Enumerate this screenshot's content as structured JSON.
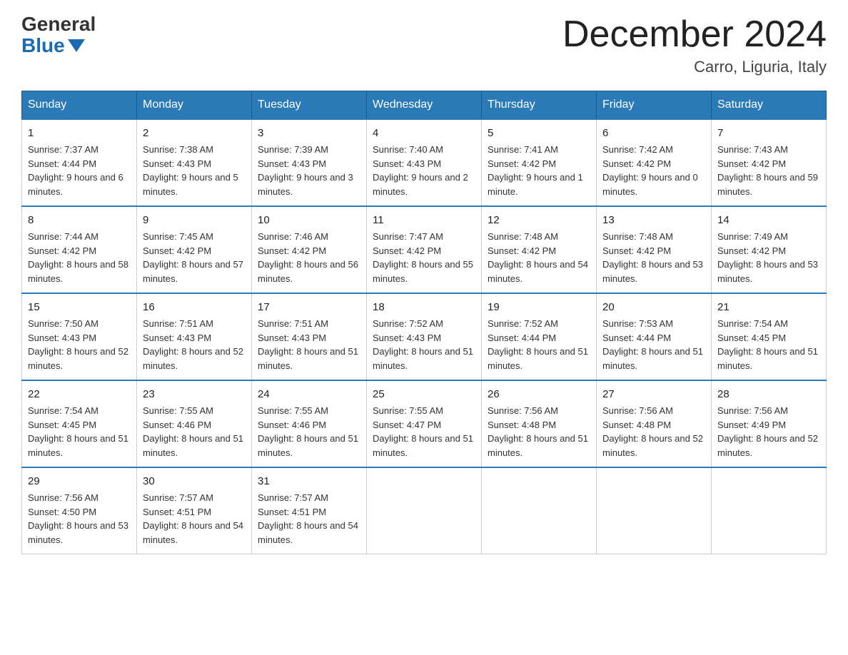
{
  "header": {
    "logo_general": "General",
    "logo_blue": "Blue",
    "month_title": "December 2024",
    "location": "Carro, Liguria, Italy"
  },
  "days_of_week": [
    "Sunday",
    "Monday",
    "Tuesday",
    "Wednesday",
    "Thursday",
    "Friday",
    "Saturday"
  ],
  "weeks": [
    [
      {
        "day": "1",
        "sunrise": "7:37 AM",
        "sunset": "4:44 PM",
        "daylight": "9 hours and 6 minutes."
      },
      {
        "day": "2",
        "sunrise": "7:38 AM",
        "sunset": "4:43 PM",
        "daylight": "9 hours and 5 minutes."
      },
      {
        "day": "3",
        "sunrise": "7:39 AM",
        "sunset": "4:43 PM",
        "daylight": "9 hours and 3 minutes."
      },
      {
        "day": "4",
        "sunrise": "7:40 AM",
        "sunset": "4:43 PM",
        "daylight": "9 hours and 2 minutes."
      },
      {
        "day": "5",
        "sunrise": "7:41 AM",
        "sunset": "4:42 PM",
        "daylight": "9 hours and 1 minute."
      },
      {
        "day": "6",
        "sunrise": "7:42 AM",
        "sunset": "4:42 PM",
        "daylight": "9 hours and 0 minutes."
      },
      {
        "day": "7",
        "sunrise": "7:43 AM",
        "sunset": "4:42 PM",
        "daylight": "8 hours and 59 minutes."
      }
    ],
    [
      {
        "day": "8",
        "sunrise": "7:44 AM",
        "sunset": "4:42 PM",
        "daylight": "8 hours and 58 minutes."
      },
      {
        "day": "9",
        "sunrise": "7:45 AM",
        "sunset": "4:42 PM",
        "daylight": "8 hours and 57 minutes."
      },
      {
        "day": "10",
        "sunrise": "7:46 AM",
        "sunset": "4:42 PM",
        "daylight": "8 hours and 56 minutes."
      },
      {
        "day": "11",
        "sunrise": "7:47 AM",
        "sunset": "4:42 PM",
        "daylight": "8 hours and 55 minutes."
      },
      {
        "day": "12",
        "sunrise": "7:48 AM",
        "sunset": "4:42 PM",
        "daylight": "8 hours and 54 minutes."
      },
      {
        "day": "13",
        "sunrise": "7:48 AM",
        "sunset": "4:42 PM",
        "daylight": "8 hours and 53 minutes."
      },
      {
        "day": "14",
        "sunrise": "7:49 AM",
        "sunset": "4:42 PM",
        "daylight": "8 hours and 53 minutes."
      }
    ],
    [
      {
        "day": "15",
        "sunrise": "7:50 AM",
        "sunset": "4:43 PM",
        "daylight": "8 hours and 52 minutes."
      },
      {
        "day": "16",
        "sunrise": "7:51 AM",
        "sunset": "4:43 PM",
        "daylight": "8 hours and 52 minutes."
      },
      {
        "day": "17",
        "sunrise": "7:51 AM",
        "sunset": "4:43 PM",
        "daylight": "8 hours and 51 minutes."
      },
      {
        "day": "18",
        "sunrise": "7:52 AM",
        "sunset": "4:43 PM",
        "daylight": "8 hours and 51 minutes."
      },
      {
        "day": "19",
        "sunrise": "7:52 AM",
        "sunset": "4:44 PM",
        "daylight": "8 hours and 51 minutes."
      },
      {
        "day": "20",
        "sunrise": "7:53 AM",
        "sunset": "4:44 PM",
        "daylight": "8 hours and 51 minutes."
      },
      {
        "day": "21",
        "sunrise": "7:54 AM",
        "sunset": "4:45 PM",
        "daylight": "8 hours and 51 minutes."
      }
    ],
    [
      {
        "day": "22",
        "sunrise": "7:54 AM",
        "sunset": "4:45 PM",
        "daylight": "8 hours and 51 minutes."
      },
      {
        "day": "23",
        "sunrise": "7:55 AM",
        "sunset": "4:46 PM",
        "daylight": "8 hours and 51 minutes."
      },
      {
        "day": "24",
        "sunrise": "7:55 AM",
        "sunset": "4:46 PM",
        "daylight": "8 hours and 51 minutes."
      },
      {
        "day": "25",
        "sunrise": "7:55 AM",
        "sunset": "4:47 PM",
        "daylight": "8 hours and 51 minutes."
      },
      {
        "day": "26",
        "sunrise": "7:56 AM",
        "sunset": "4:48 PM",
        "daylight": "8 hours and 51 minutes."
      },
      {
        "day": "27",
        "sunrise": "7:56 AM",
        "sunset": "4:48 PM",
        "daylight": "8 hours and 52 minutes."
      },
      {
        "day": "28",
        "sunrise": "7:56 AM",
        "sunset": "4:49 PM",
        "daylight": "8 hours and 52 minutes."
      }
    ],
    [
      {
        "day": "29",
        "sunrise": "7:56 AM",
        "sunset": "4:50 PM",
        "daylight": "8 hours and 53 minutes."
      },
      {
        "day": "30",
        "sunrise": "7:57 AM",
        "sunset": "4:51 PM",
        "daylight": "8 hours and 54 minutes."
      },
      {
        "day": "31",
        "sunrise": "7:57 AM",
        "sunset": "4:51 PM",
        "daylight": "8 hours and 54 minutes."
      },
      null,
      null,
      null,
      null
    ]
  ],
  "labels": {
    "sunrise": "Sunrise:",
    "sunset": "Sunset:",
    "daylight": "Daylight:"
  }
}
